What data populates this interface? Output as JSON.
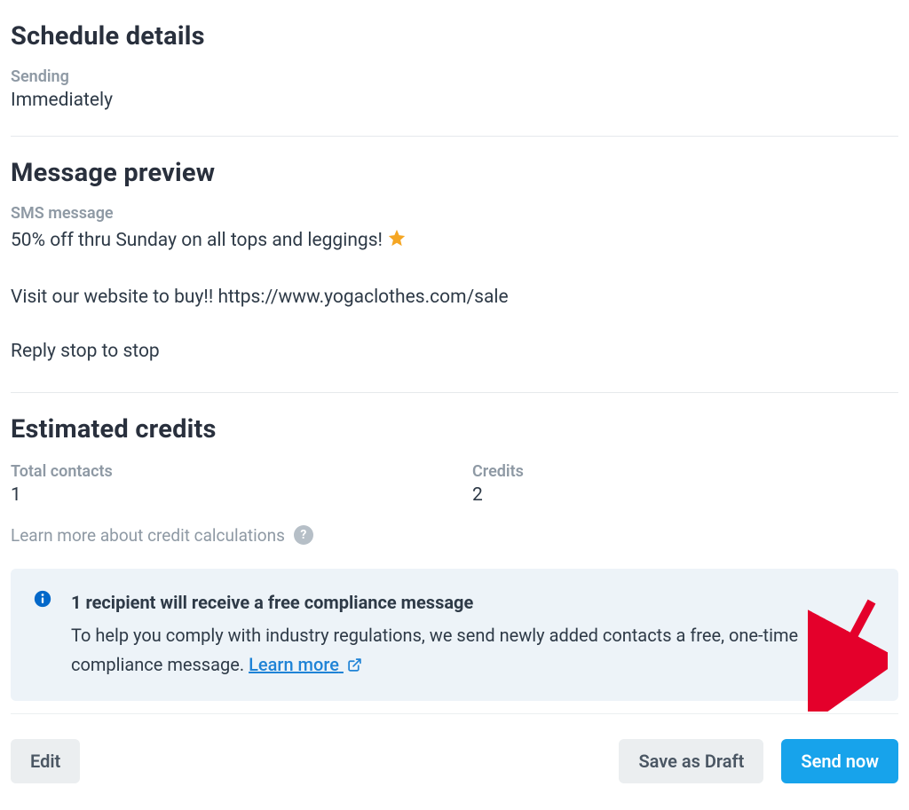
{
  "schedule": {
    "heading": "Schedule details",
    "sending_label": "Sending",
    "sending_value": "Immediately"
  },
  "preview": {
    "heading": "Message preview",
    "sms_label": "SMS message",
    "line1": "50% off thru Sunday on all tops and leggings!",
    "line2": "Visit our website to buy!! https://www.yogaclothes.com/sale",
    "line3": "Reply stop to stop"
  },
  "credits": {
    "heading": "Estimated credits",
    "total_contacts_label": "Total contacts",
    "total_contacts_value": "1",
    "credits_label": "Credits",
    "credits_value": "2",
    "learn_more_text": "Learn more about credit calculations",
    "help_glyph": "?"
  },
  "banner": {
    "title": "1 recipient will receive a free compliance message",
    "body": "To help you comply with industry regulations, we send newly added contacts a free, one-time compliance message. ",
    "link_text": "Learn more"
  },
  "actions": {
    "edit": "Edit",
    "save_draft": "Save as Draft",
    "send_now": "Send now"
  }
}
